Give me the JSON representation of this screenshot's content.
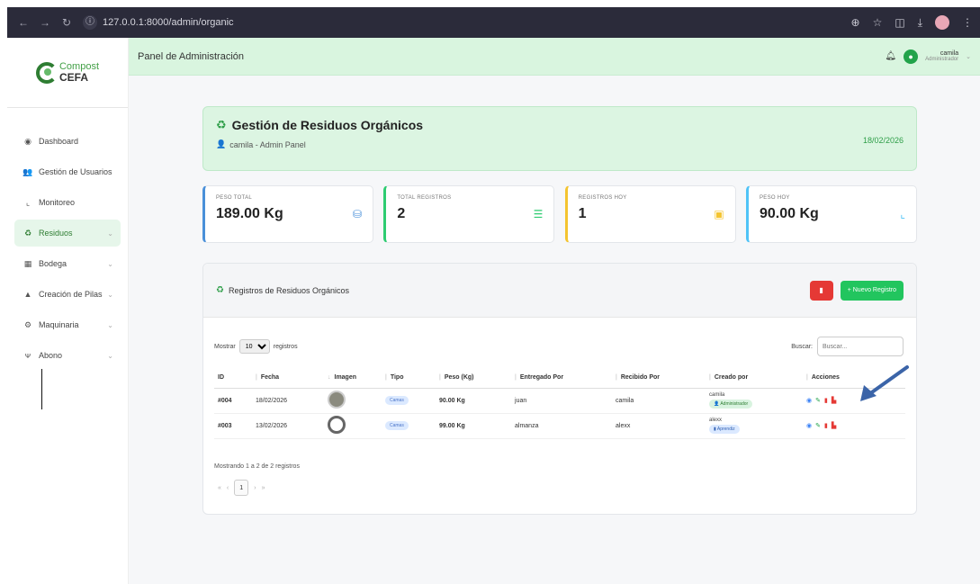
{
  "browser": {
    "url": "127.0.0.1:8000/admin/organic"
  },
  "logo": {
    "line1": "Compost",
    "line2": "CEFA"
  },
  "sidebar": {
    "items": [
      {
        "label": "Dashboard",
        "icon": "dashboard-icon"
      },
      {
        "label": "Gestión de Usuarios",
        "icon": "users-icon"
      },
      {
        "label": "Monitoreo",
        "icon": "chart-icon"
      },
      {
        "label": "Residuos",
        "icon": "recycle-icon"
      },
      {
        "label": "Bodega",
        "icon": "warehouse-icon"
      },
      {
        "label": "Creación de Pilas",
        "icon": "mountain-icon"
      },
      {
        "label": "Maquinaria",
        "icon": "gears-icon"
      },
      {
        "label": "Abono",
        "icon": "seedling-icon"
      }
    ]
  },
  "topbar": {
    "title": "Panel de Administración",
    "user_name": "camila",
    "user_role": "Administrador"
  },
  "header": {
    "title": "Gestión de Residuos Orgánicos",
    "subtitle": "camila - Admin Panel",
    "date": "18/02/2026"
  },
  "stats": [
    {
      "label": "PESO TOTAL",
      "value": "189.00 Kg"
    },
    {
      "label": "TOTAL REGISTROS",
      "value": "2"
    },
    {
      "label": "REGISTROS HOY",
      "value": "1"
    },
    {
      "label": "PESO HOY",
      "value": "90.00 Kg"
    }
  ],
  "table_card": {
    "title": "Registros de Residuos Orgánicos",
    "new_button": "+ Nuevo Registro",
    "show_label": "Mostrar",
    "page_size": "10",
    "records_label": "registros",
    "search_label": "Buscar:",
    "search_placeholder": "Buscar...",
    "columns": [
      "ID",
      "Fecha",
      "Imagen",
      "Tipo",
      "Peso (Kg)",
      "Entregado Por",
      "Recibido Por",
      "Creado por",
      "Acciones"
    ],
    "rows": [
      {
        "id": "#004",
        "fecha": "18/02/2026",
        "tipo": "Camas",
        "peso": "90.00 Kg",
        "entregado": "juan",
        "recibido": "camila",
        "creado": "camila",
        "rol": "Administrador"
      },
      {
        "id": "#003",
        "fecha": "13/02/2026",
        "tipo": "Camas",
        "peso": "99.00 Kg",
        "entregado": "almanza",
        "recibido": "alexx",
        "creado": "alexx",
        "rol": "Aprendiz"
      }
    ],
    "showing": "Mostrando 1 a 2 de 2 registros",
    "current_page": "1"
  },
  "colors": {
    "accent": "#22c55e",
    "danger": "#e53935",
    "topbar": "#d9f5df"
  }
}
